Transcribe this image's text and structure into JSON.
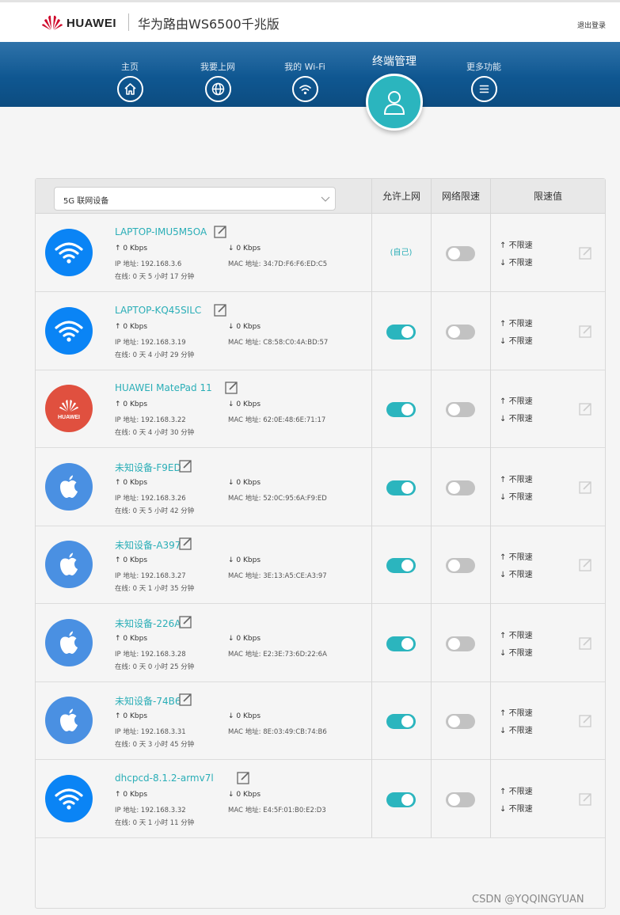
{
  "header": {
    "brand": "HUAWEI",
    "product": "华为路由WS6500千兆版",
    "logout": "退出登录"
  },
  "nav": {
    "items": [
      {
        "label": "主页",
        "icon": "home-icon"
      },
      {
        "label": "我要上网",
        "icon": "globe-icon"
      },
      {
        "label": "我的 Wi-Fi",
        "icon": "wifi-icon"
      },
      {
        "label": "终端管理",
        "icon": "user-icon",
        "active": true
      },
      {
        "label": "更多功能",
        "icon": "menu-icon"
      }
    ]
  },
  "table": {
    "filter": "5G 联网设备",
    "headers": [
      "允许上网",
      "网络限速",
      "限速值"
    ],
    "up_arrow": "↑",
    "down_arrow": "↓",
    "limit_value": "不限速",
    "ip_prefix": "IP 地址: ",
    "mac_prefix": "MAC 地址: ",
    "online_prefix": "在线: ",
    "devices": [
      {
        "name": "LAPTOP-IMU5M5OA",
        "icon": "wifi-icon",
        "up": "0 Kbps",
        "down": "0 Kbps",
        "ip": "192.168.3.6",
        "mac": "34:7D:F6:F6:ED:C5",
        "online": "0 天 5 小时 17 分钟",
        "allow": "(自己)",
        "limit": false
      },
      {
        "name": "LAPTOP-KQ45SILC",
        "icon": "wifi-icon",
        "up": "0 Kbps",
        "down": "0 Kbps",
        "ip": "192.168.3.19",
        "mac": "C8:58:C0:4A:BD:57",
        "online": "0 天 4 小时 29 分钟",
        "allow": true,
        "limit": false
      },
      {
        "name": "HUAWEI MatePad 11",
        "icon": "huawei-logo-icon",
        "up": "0 Kbps",
        "down": "0 Kbps",
        "ip": "192.168.3.22",
        "mac": "62:0E:48:6E:71:17",
        "online": "0 天 4 小时 30 分钟",
        "allow": true,
        "limit": false
      },
      {
        "name": "未知设备-F9ED",
        "icon": "apple-icon",
        "up": "0 Kbps",
        "down": "0 Kbps",
        "ip": "192.168.3.26",
        "mac": "52:0C:95:6A:F9:ED",
        "online": "0 天 5 小时 42 分钟",
        "allow": true,
        "limit": false
      },
      {
        "name": "未知设备-A397",
        "icon": "apple-icon",
        "up": "0 Kbps",
        "down": "0 Kbps",
        "ip": "192.168.3.27",
        "mac": "3E:13:A5:CE:A3:97",
        "online": "0 天 1 小时 35 分钟",
        "allow": true,
        "limit": false
      },
      {
        "name": "未知设备-226A",
        "icon": "apple-icon",
        "up": "0 Kbps",
        "down": "0 Kbps",
        "ip": "192.168.3.28",
        "mac": "E2:3E:73:6D:22:6A",
        "online": "0 天 0 小时 25 分钟",
        "allow": true,
        "limit": false
      },
      {
        "name": "未知设备-74B6",
        "icon": "apple-icon",
        "up": "0 Kbps",
        "down": "0 Kbps",
        "ip": "192.168.3.31",
        "mac": "8E:03:49:CB:74:B6",
        "online": "0 天 3 小时 45 分钟",
        "allow": true,
        "limit": false
      },
      {
        "name": "dhcpcd-8.1.2-armv7l",
        "icon": "wifi-icon",
        "up": "0 Kbps",
        "down": "0 Kbps",
        "ip": "192.168.3.32",
        "mac": "E4:5F:01:B0:E2:D3",
        "online": "0 天 1 小时 11 分钟",
        "allow": true,
        "limit": false
      }
    ]
  },
  "colors": {
    "accent": "#2bb5be",
    "nav": "#0f5791",
    "wifi_avatar": "#0a84f5",
    "apple_avatar": "#4a90e2",
    "huawei_avatar": "#e0503f"
  },
  "watermark": "CSDN @YQQINGYUAN"
}
